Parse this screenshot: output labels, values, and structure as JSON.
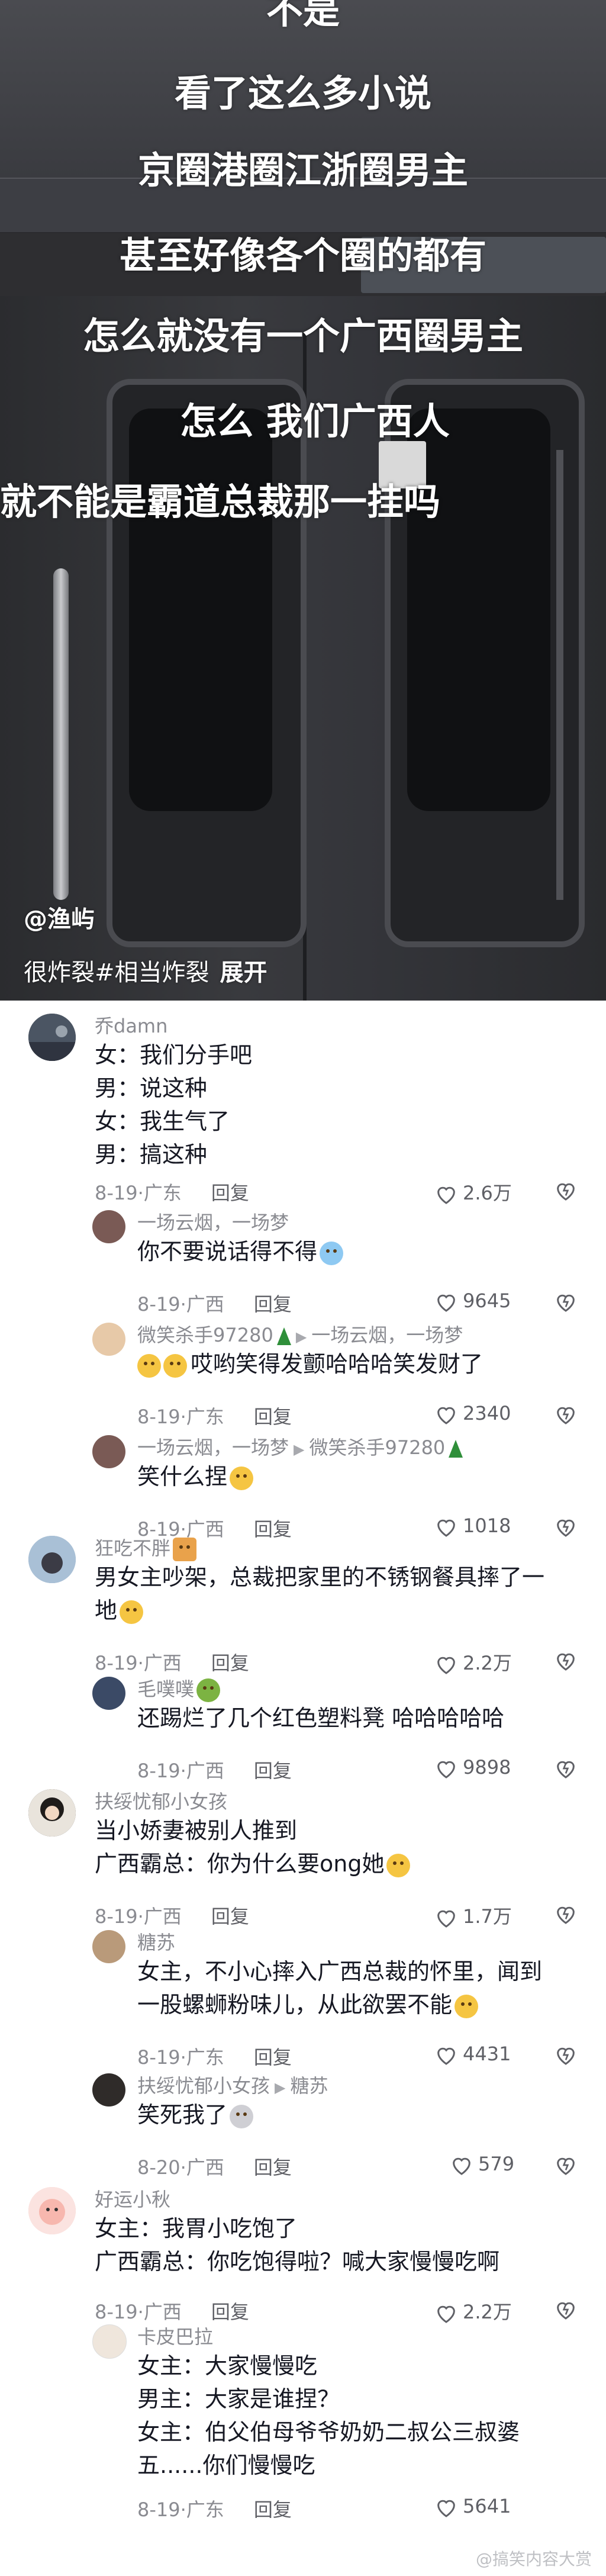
{
  "video": {
    "overlay_lines": [
      "不是",
      "看了这么多小说",
      "京圈港圈江浙圈男主",
      "甚至好像各个圈的都有",
      "怎么就没有一个广西圈男主",
      "怎么 我们广西人",
      "就不能是霸道总裁那一挂吗"
    ],
    "author": "@渔屿",
    "description": "很炸裂#相当炸裂",
    "expand_label": "展开"
  },
  "comments": [
    {
      "user": "乔damn",
      "lines": [
        "女：我们分手吧",
        "男：说这种",
        "女：我生气了",
        "男：搞这种"
      ],
      "date": "8-19",
      "location": "广东",
      "reply_label": "回复",
      "likes": "2.6万",
      "avatar_color": "#3a3f48"
    },
    {
      "user": "一场云烟，一场梦",
      "lines": [
        "你不要说话得不得"
      ],
      "emoji": "crying-face",
      "date": "8-19",
      "location": "广西",
      "reply_label": "回复",
      "likes": "9645",
      "avatar_color": "#7a5a55"
    },
    {
      "user": "微笑杀手97280",
      "reply_to": "一场云烟，一场梦",
      "lines": [
        "哎哟笑得发颤哈哈哈笑发财了"
      ],
      "emoji": "laughing-face",
      "date": "8-19",
      "location": "广东",
      "reply_label": "回复",
      "likes": "2340",
      "avatar_color": "#e7c9a8"
    },
    {
      "user": "一场云烟，一场梦",
      "reply_to": "微笑杀手97280",
      "lines": [
        "笑什么捏"
      ],
      "emoji": "worried-face",
      "date": "8-19",
      "location": "广西",
      "reply_label": "回复",
      "likes": "1018",
      "avatar_color": "#7a5a55"
    },
    {
      "user": "狂吃不胖",
      "lines": [
        "男女主吵架，总裁把家里的不锈钢餐具摔了一",
        "地"
      ],
      "emoji": "grinning-sweat-face",
      "date": "8-19",
      "location": "广西",
      "reply_label": "回复",
      "likes": "2.2万",
      "avatar_color": "#8aa6c1"
    },
    {
      "user": "毛噗噗",
      "lines": [
        "还踢烂了几个红色塑料凳 哈哈哈哈哈"
      ],
      "date": "8-19",
      "location": "广西",
      "reply_label": "回复",
      "likes": "9898",
      "avatar_color": "#3b4a66"
    },
    {
      "user": "扶绥忧郁小女孩",
      "lines": [
        "当小娇妻被别人推到",
        "广西霸总：你为什么要ong她"
      ],
      "emoji": "headphones-face",
      "date": "8-19",
      "location": "广西",
      "reply_label": "回复",
      "likes": "1.7万",
      "avatar_color": "#2f2b29"
    },
    {
      "user": "糖苏",
      "lines": [
        "女主，不小心摔入广西总裁的怀里，闻到",
        "一股螺蛳粉味儿，从此欲罢不能"
      ],
      "emoji": "pleading-face",
      "date": "8-19",
      "location": "广东",
      "reply_label": "回复",
      "likes": "4431",
      "avatar_color": "#b99a7a"
    },
    {
      "user": "扶绥忧郁小女孩",
      "reply_to": "糖苏",
      "lines": [
        "笑死我了"
      ],
      "emoji": "cat-face",
      "date": "8-20",
      "location": "广西",
      "reply_label": "回复",
      "likes": "579",
      "avatar_color": "#2f2b29"
    },
    {
      "user": "好运小秋",
      "lines": [
        "女主：我胃小吃饱了",
        "广西霸总：你吃饱得啦？喊大家慢慢吃啊"
      ],
      "date": "8-19",
      "location": "广西",
      "reply_label": "回复",
      "likes": "2.2万",
      "avatar_color": "#f2c9c4"
    },
    {
      "user": "卡皮巴拉",
      "lines": [
        "女主：大家慢慢吃",
        "男主：大家是谁捏？",
        "女主：伯父伯母爷爷奶奶二叔公三叔婆",
        "五......你们慢慢吃"
      ],
      "date": "8-19",
      "location": "广东",
      "reply_label": "回复",
      "likes": "5641",
      "avatar_color": "#efe6dc"
    }
  ],
  "watermark": "@搞笑内容大赏"
}
